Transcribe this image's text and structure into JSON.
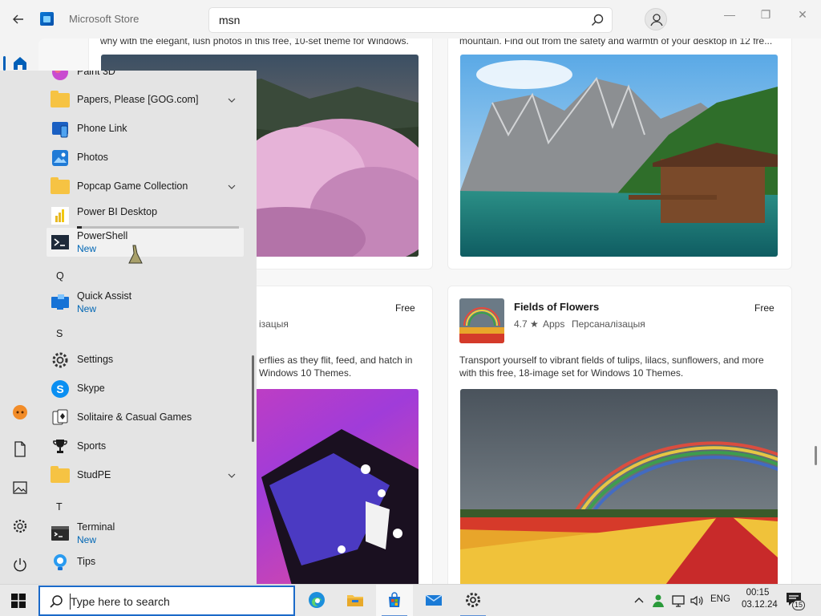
{
  "window": {
    "title": "Microsoft Store",
    "search_value": "msn",
    "controls": {
      "minimize": "—",
      "maximize": "❐",
      "close": "✕"
    }
  },
  "store_cards": {
    "top_left_desc": "why with the elegant, lush photos in this free, 10-set theme for Windows.",
    "top_right_desc": "mountain. Find out from the safety and warmth of your desktop in 12 fre...",
    "mid_left": {
      "price": "Free",
      "meta_fragment": "ізацыя",
      "desc_line1": "erflies as they flit, feed, and hatch in",
      "desc_line2": "Windows 10 Themes."
    },
    "mid_right": {
      "title": "Fields of Flowers",
      "price": "Free",
      "rating": "4.7 ★",
      "category": "Apps",
      "subcategory": "Персаналізацыя",
      "desc_line1": "Transport yourself to vibrant fields of tulips, lilacs, sunflowers, and more",
      "desc_line2": "with this free, 18-image set for Windows 10 Themes."
    }
  },
  "start_menu": {
    "apps": [
      {
        "name": "Paint 3D"
      },
      {
        "name": "Papers, Please [GOG.com]"
      },
      {
        "name": "Phone Link"
      },
      {
        "name": "Photos"
      },
      {
        "name": "Popcap Game Collection"
      },
      {
        "name": "Power BI Desktop",
        "progress": 0.03
      },
      {
        "name": "PowerShell",
        "badge": "New"
      },
      {
        "name": "Quick Assist",
        "badge": "New"
      },
      {
        "name": "Settings"
      },
      {
        "name": "Skype"
      },
      {
        "name": "Solitaire & Casual Games"
      },
      {
        "name": "Sports"
      },
      {
        "name": "StudPE"
      },
      {
        "name": "Terminal",
        "badge": "New"
      },
      {
        "name": "Tips"
      }
    ],
    "letters": [
      "Q",
      "S",
      "T"
    ]
  },
  "taskbar": {
    "search_placeholder": "Type here to search",
    "tray": {
      "language": "ENG",
      "time": "00:15",
      "date": "03.12.24",
      "notification_count": "15"
    }
  },
  "colors": {
    "accent": "#005fb8",
    "new_badge": "#0066b4",
    "folder": "#f6c343"
  }
}
